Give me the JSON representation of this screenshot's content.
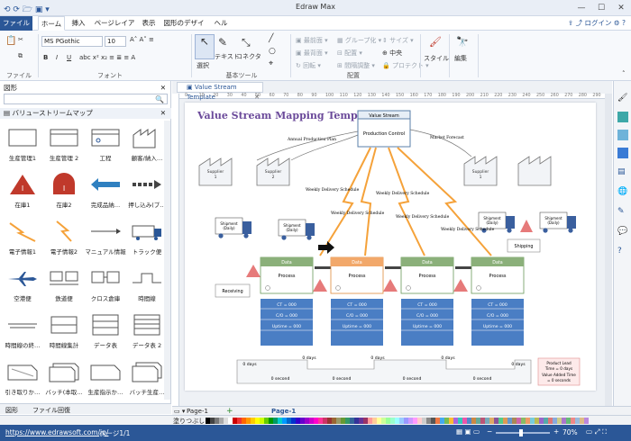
{
  "app": {
    "title": "Edraw Max"
  },
  "menu": {
    "tabs": [
      "ファイル",
      "ホーム",
      "挿入",
      "ページレイアウト",
      "表示",
      "図形のデザイン",
      "ヘルプ"
    ],
    "login": "ログイン"
  },
  "ribbon": {
    "font_name": "MS PGothic",
    "font_size": "10",
    "select": "選択",
    "text": "テキスト",
    "connector": "コネクタ",
    "front": "最前面",
    "back": "最背面",
    "rotate": "回転",
    "group": "グループ化",
    "arrange": "配置",
    "spacing": "間隔調整",
    "size": "サイズ",
    "center": "中央",
    "protect": "プロテクト",
    "style": "スタイル",
    "edit": "編集",
    "groups": {
      "file": "ファイル",
      "font": "フォント",
      "basic_tools": "基本ツール",
      "arrange": "配置"
    }
  },
  "panel": {
    "title": "図形",
    "library": "バリューストリームマップ",
    "shapes": [
      "生産管理1",
      "生産管理 2",
      "工程",
      "顧客/納入…",
      "在庫1",
      "在庫2",
      "完成品納…",
      "押し込み(プ…",
      "電子情報1",
      "電子情報2",
      "マニュアル情報",
      "トラック便",
      "空港便",
      "鉄道便",
      "クロス倉庫",
      "時間線",
      "時間線の終…",
      "時間線集計",
      "データ表",
      "データ表 2",
      "引き取りか…",
      "バッチ(本取…",
      "生産指示か…",
      "バッチ生産…"
    ],
    "bottom_tabs": [
      "図形",
      "ファイル回復"
    ]
  },
  "document": {
    "tab": "Value Stream Template"
  },
  "ruler": [
    "0",
    "10",
    "20",
    "30",
    "40",
    "50",
    "60",
    "70",
    "80",
    "90",
    "100",
    "110",
    "120",
    "130",
    "140",
    "150",
    "160",
    "170",
    "180",
    "190",
    "200",
    "210",
    "220",
    "230",
    "240",
    "250",
    "260",
    "270",
    "280",
    "290"
  ],
  "diagram": {
    "title": "Value Stream Mapping Template",
    "control_header": "Value Stream",
    "production_control": "Production Control",
    "annual_plan": "Annual Production Plan",
    "market_forecast": "Market Forecast",
    "supplier1": "Supplier\n1",
    "supplier2": "Supplier\n2",
    "customer": "Supplier\n1",
    "shipment": "Shipment\n(Daily)",
    "shipping": "Shipping",
    "receiving": "Receiving",
    "weekly": "Weekly Delivery Schedule",
    "process_header": "Data",
    "process_label": "Process",
    "ct": "CT = 000",
    "co": "C/O = 000",
    "uptime": "Uptime = 000",
    "days": "0 days",
    "second": "0 second",
    "lead_time": "Product Lead Time = 0 days",
    "value_added": "Value Added Time = 0 seconds"
  },
  "pages": {
    "current": "Page-1",
    "tab": "Page-1"
  },
  "colors_label": "塗りつぶし",
  "status": {
    "url": "https://www.edrawsoft.com/jp/",
    "page": "ページ1/1",
    "zoom": "70%"
  }
}
